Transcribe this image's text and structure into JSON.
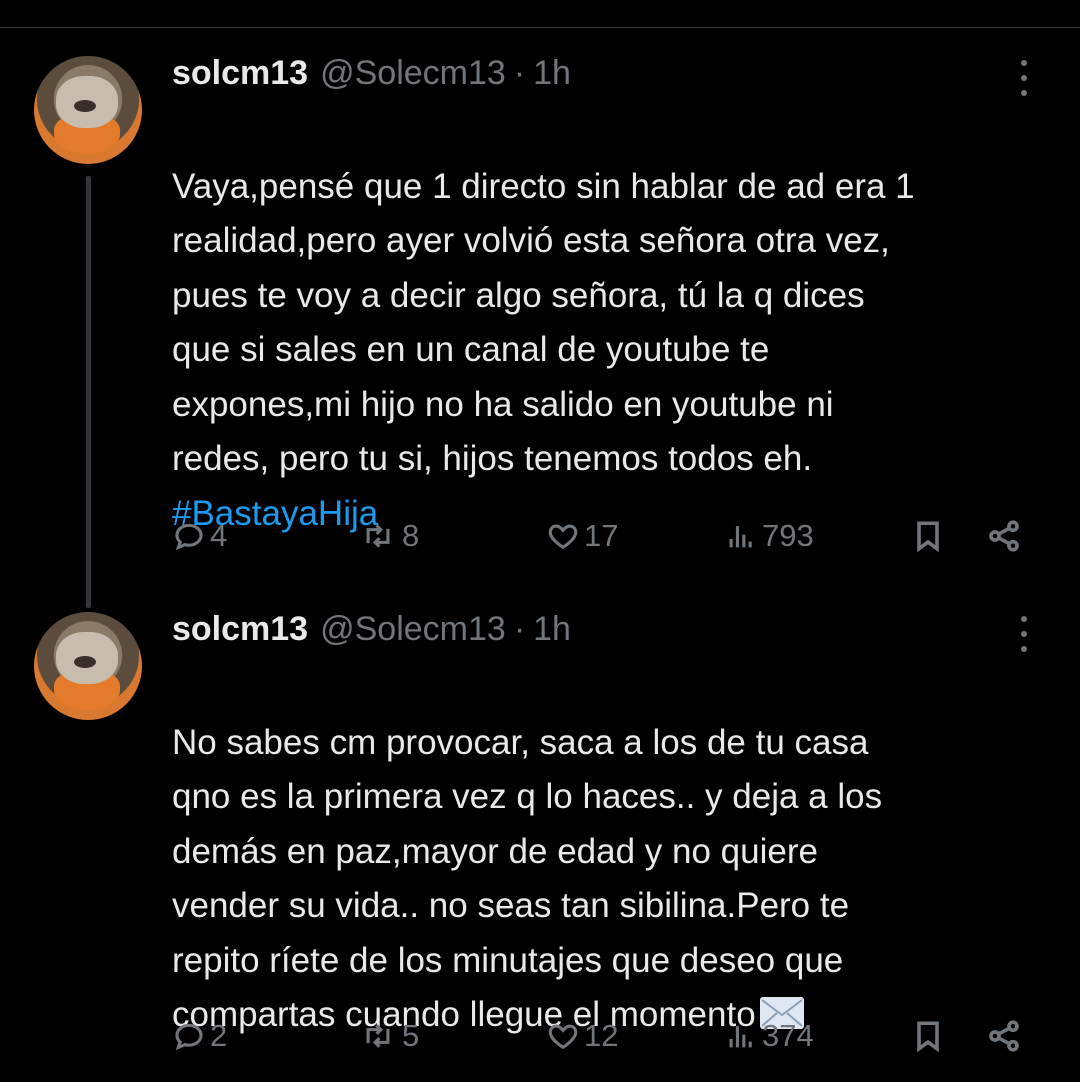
{
  "tweets": [
    {
      "display_name": "solcm13",
      "handle": "@Solecm13",
      "separator": "·",
      "time": "1h",
      "text": "Vaya,pensé que 1 directo sin hablar de ad era 1\nrealidad,pero ayer volvió esta señora otra vez,\npues te voy a decir algo señora, tú la q dices\nque si sales en un canal de youtube te\nexpones,mi hijo no ha salido en youtube ni\nredes, pero tu si, hijos tenemos todos eh.",
      "hashtag": "#BastayaHija",
      "emoji": "",
      "replies": "4",
      "reposts": "8",
      "likes": "17",
      "views": "793"
    },
    {
      "display_name": "solcm13",
      "handle": "@Solecm13",
      "separator": "·",
      "time": "1h",
      "text": "No sabes cm provocar, saca a los de tu casa\nqno es la primera vez q lo haces.. y deja a los\ndemás en paz,mayor de edad y no quiere\nvender su vida.. no seas tan sibilina.Pero te\nrepito ríete de los minutajes que deseo que\ncompartas cuando llegue el momento",
      "hashtag": "",
      "emoji": "envelope-emoji",
      "replies": "2",
      "reposts": "5",
      "likes": "12",
      "views": "374"
    }
  ],
  "icons": {
    "reply": "reply-icon",
    "repost": "repost-icon",
    "like": "heart-icon",
    "views": "views-icon",
    "bookmark": "bookmark-icon",
    "share": "share-icon",
    "more": "more-icon"
  },
  "colors": {
    "background": "#000000",
    "text": "#e7e9ea",
    "muted": "#71767b",
    "hashtag": "#1d9bf0",
    "thread_line": "#333639"
  }
}
